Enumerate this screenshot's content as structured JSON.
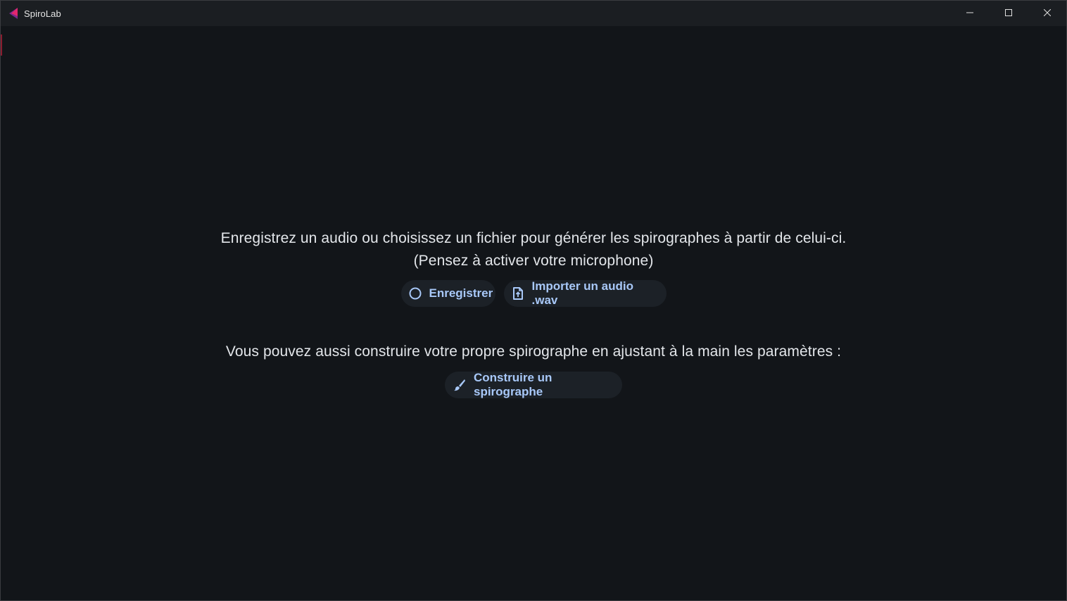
{
  "window": {
    "title": "SpiroLab",
    "controls": {
      "minimize_icon": "minimize-icon",
      "maximize_icon": "maximize-icon",
      "close_icon": "close-icon"
    }
  },
  "main": {
    "intro_line1": "Enregistrez un audio ou choisissez un fichier pour générer les spirographes à partir de celui-ci.",
    "intro_line2": "(Pensez à activer votre microphone)",
    "record_button": {
      "label": "Enregistrer",
      "icon": "record-circle-icon"
    },
    "import_button": {
      "label": "Importer un audio .wav",
      "icon": "file-upload-icon"
    },
    "manual_text": "Vous pouvez aussi construire votre propre spirographe en ajustant à la main les paramètres :",
    "build_button": {
      "label": "Construire un spirographe",
      "icon": "brush-icon"
    }
  },
  "colors": {
    "background": "#121519",
    "titlebar": "#1b1e22",
    "button_bg": "#1c2127",
    "button_text": "#a8c8f8",
    "text": "#e3e6ea",
    "brand_pink": "#e3266e",
    "brand_purple": "#7a2a8c"
  }
}
